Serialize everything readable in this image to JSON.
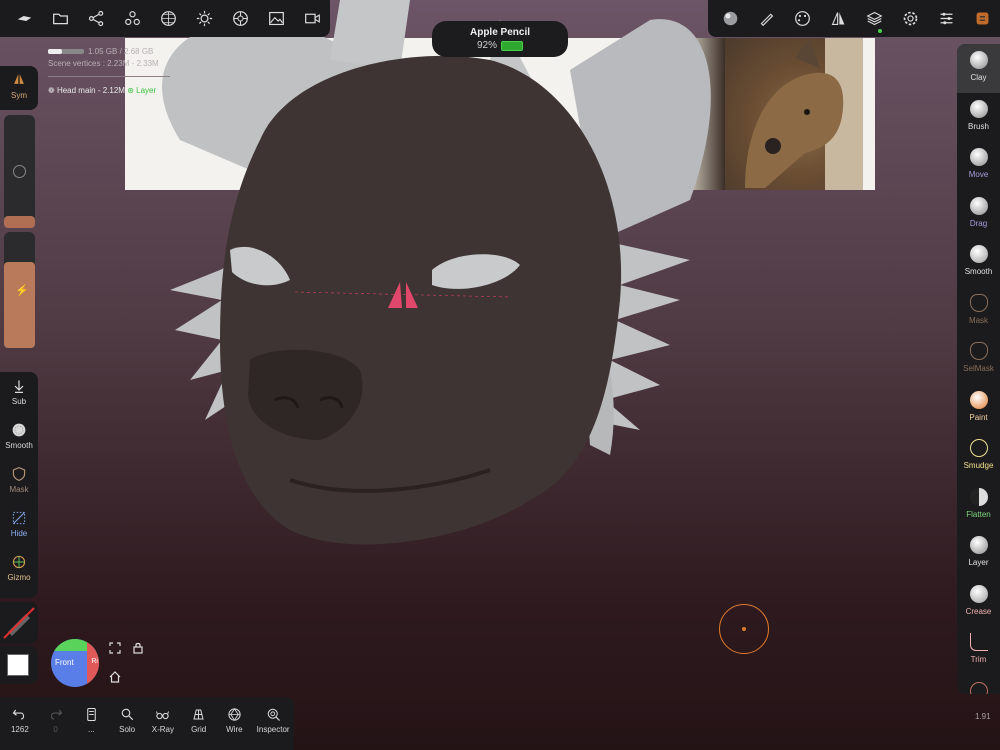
{
  "stats": {
    "memory": "1.05 GB / 2.68 GB",
    "memory_fraction": 0.39,
    "vertices": "Scene vertices : 2.23M - 2.33M",
    "mesh": "Head main - 2.12M",
    "layer": "Layer"
  },
  "pencil": {
    "name": "Apple Pencil",
    "battery": "92%"
  },
  "left": {
    "sym": "Sym",
    "tools": [
      "Sub",
      "Smooth",
      "Mask",
      "Hide",
      "Gizmo"
    ]
  },
  "view": {
    "cube_front": "Front",
    "cube_right": "Ri"
  },
  "bottom": {
    "undo": "1262",
    "redo": "0",
    "hist": "...",
    "items": [
      "Solo",
      "X-Ray",
      "Grid",
      "Wire",
      "Inspector"
    ]
  },
  "right_tools": [
    {
      "label": "Clay",
      "color": "#e0e0e0"
    },
    {
      "label": "Brush",
      "color": "#e0e0e0"
    },
    {
      "label": "Move",
      "color": "#a99be0"
    },
    {
      "label": "Drag",
      "color": "#a99be0"
    },
    {
      "label": "Smooth",
      "color": "#e0e0e0"
    },
    {
      "label": "Mask",
      "color": "#8a6e5a"
    },
    {
      "label": "SelMask",
      "color": "#8a6e5a"
    },
    {
      "label": "Paint",
      "color": "#f0d0a0"
    },
    {
      "label": "Smudge",
      "color": "#f0e090"
    },
    {
      "label": "Flatten",
      "color": "#7fd67f"
    },
    {
      "label": "Layer",
      "color": "#e0e0e0"
    },
    {
      "label": "Crease",
      "color": "#f0b0b0"
    },
    {
      "label": "Trim",
      "color": "#f0b0b0"
    }
  ],
  "version": "1.91",
  "colors": {
    "accent": "#e07a2a",
    "skin_dark": "#3e3433",
    "clay": "#bfc1c3"
  }
}
